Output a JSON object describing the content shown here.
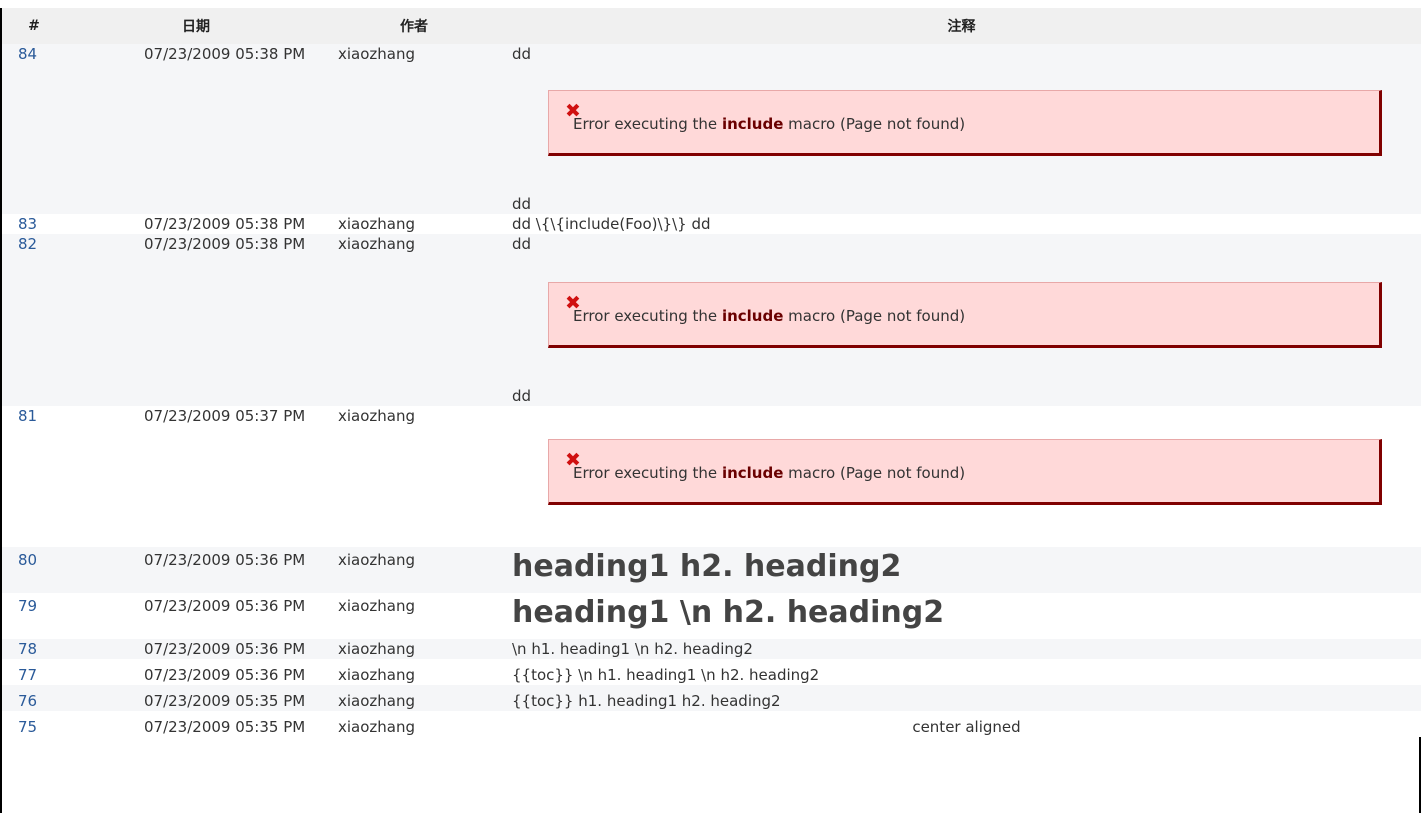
{
  "headers": {
    "num": "#",
    "date": "日期",
    "author": "作者",
    "comment": "注释"
  },
  "error": {
    "pre": "Error executing the ",
    "macro": "include",
    "post": " macro (Page not found)"
  },
  "rows": [
    {
      "num": "84",
      "date": "07/23/2009 05:38 PM",
      "author": "xiaozhang",
      "top": "dd",
      "bottom": "dd"
    },
    {
      "num": "83",
      "date": "07/23/2009 05:38 PM",
      "author": "xiaozhang",
      "text": "dd \\{\\{include(Foo)\\}\\} dd"
    },
    {
      "num": "82",
      "date": "07/23/2009 05:38 PM",
      "author": "xiaozhang",
      "top": "dd",
      "bottom": "dd"
    },
    {
      "num": "81",
      "date": "07/23/2009 05:37 PM",
      "author": "xiaozhang"
    },
    {
      "num": "80",
      "date": "07/23/2009 05:36 PM",
      "author": "xiaozhang",
      "text": "heading1 h2. heading2"
    },
    {
      "num": "79",
      "date": "07/23/2009 05:36 PM",
      "author": "xiaozhang",
      "text": "heading1 \\n h2. heading2"
    },
    {
      "num": "78",
      "date": "07/23/2009 05:36 PM",
      "author": "xiaozhang",
      "text": "\\n h1. heading1 \\n h2. heading2"
    },
    {
      "num": "77",
      "date": "07/23/2009 05:36 PM",
      "author": "xiaozhang",
      "text": "{{toc}} \\n h1. heading1 \\n h2. heading2"
    },
    {
      "num": "76",
      "date": "07/23/2009 05:35 PM",
      "author": "xiaozhang",
      "text": "{{toc}} h1. heading1 h2. heading2"
    },
    {
      "num": "75",
      "date": "07/23/2009 05:35 PM",
      "author": "xiaozhang",
      "text": "center aligned"
    }
  ]
}
